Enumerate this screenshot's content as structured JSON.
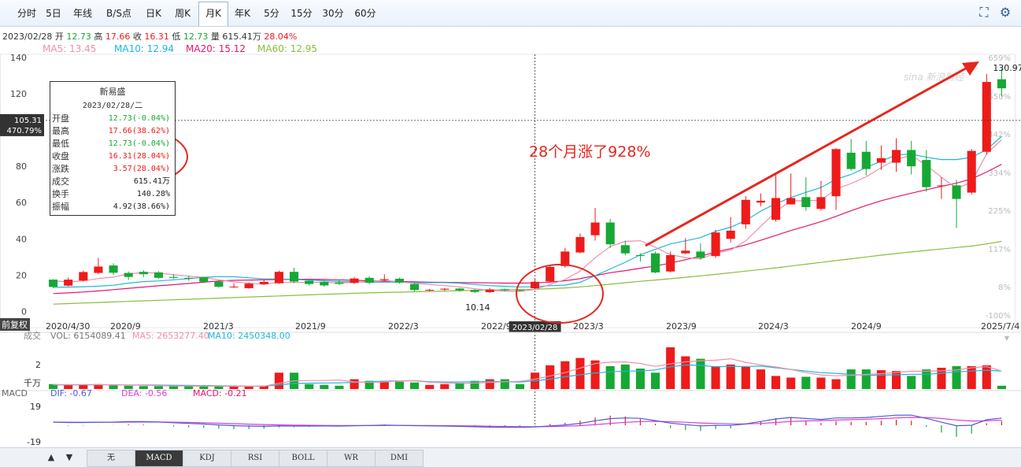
{
  "toolbar": {
    "tabs": [
      "分时",
      "5日",
      "年线",
      "B/S点",
      "日K",
      "周K",
      "月K",
      "年K",
      "5分",
      "15分",
      "30分",
      "60分"
    ],
    "active": "月K",
    "fullscreen_icon": "fullscreen-icon",
    "settings_icon": "settings-icon"
  },
  "info_line": {
    "date": "2023/02/28",
    "open_label": "开",
    "open": "12.73",
    "high_label": "高",
    "high": "17.66",
    "close_label": "收",
    "close": "16.31",
    "low_label": "低",
    "low": "12.73",
    "vol_label": "量",
    "vol": "615.41万",
    "pct": "28.04%"
  },
  "ma_line": {
    "ma5": "MA5: 13.45",
    "ma10": "MA10: 12.94",
    "ma20": "MA20: 15.12",
    "ma60": "MA60: 12.95"
  },
  "colors": {
    "up": "#ee1b1b",
    "down": "#16a834",
    "ma5": "#f08fa8",
    "ma10": "#1bb9d8",
    "ma20": "#e5156d",
    "ma60": "#86be3c",
    "annotation": "#e5271f",
    "dif": "#4f5bd5",
    "dea": "#d93ed8"
  },
  "chart_data": {
    "type": "candlestick",
    "y_axis": {
      "ticks": [
        "140",
        "120",
        "100",
        "80",
        "60",
        "40",
        "20",
        "0"
      ],
      "ylim": [
        -2,
        140
      ]
    },
    "right_axis": {
      "ticks": [
        "659%",
        "550%",
        "442%",
        "334%",
        "225%",
        "117%",
        "8%",
        "-100%"
      ]
    },
    "x_axis": {
      "ticks": [
        "2020/4/30",
        "2020/9",
        "2021/3",
        "2021/9",
        "2022/3",
        "2022/9",
        "2023/3",
        "2023/9",
        "2024/3",
        "2024/9",
        "2025/7/4"
      ]
    },
    "crosshair": {
      "price_label": "105.31",
      "pct_label": "470.79%",
      "date_label": "2023/02/28"
    },
    "max_label": "130.97",
    "min_label": "10.14",
    "watermark": "sina 新浪财经",
    "annotation_text": "28个月涨了928%",
    "candles": [
      [
        17.5,
        13.5,
        17.8,
        12.9
      ],
      [
        14.2,
        17.5,
        18.6,
        13.8
      ],
      [
        17.0,
        21.7,
        22.5,
        16.5
      ],
      [
        21.2,
        24.7,
        29.5,
        20.5
      ],
      [
        25.3,
        21.3,
        26.5,
        20.0
      ],
      [
        21.2,
        19.0,
        22.0,
        17.3
      ],
      [
        21.8,
        20.5,
        22.7,
        18.9
      ],
      [
        21.5,
        18.5,
        22.2,
        17.8
      ],
      [
        19.0,
        18.5,
        20.6,
        17.9
      ],
      [
        18.5,
        18.0,
        19.8,
        16.9
      ],
      [
        18.8,
        16.3,
        19.2,
        15.6
      ],
      [
        16.4,
        13.6,
        17.2,
        13.0
      ],
      [
        13.5,
        13.7,
        15.5,
        12.8
      ],
      [
        12.8,
        15.3,
        15.9,
        12.5
      ],
      [
        15.0,
        16.3,
        17.3,
        14.6
      ],
      [
        15.5,
        21.8,
        22.5,
        15.2
      ],
      [
        21.8,
        16.4,
        24.0,
        15.6
      ],
      [
        16.9,
        15.1,
        17.2,
        14.3
      ],
      [
        16.3,
        14.3,
        16.7,
        13.6
      ],
      [
        16.0,
        15.2,
        17.3,
        14.5
      ],
      [
        15.7,
        18.1,
        19.0,
        15.1
      ],
      [
        18.5,
        15.8,
        19.4,
        15.0
      ],
      [
        17.5,
        17.8,
        20.4,
        16.8
      ],
      [
        18.0,
        15.9,
        18.7,
        15.3
      ],
      [
        15.1,
        11.8,
        15.7,
        10.9
      ],
      [
        11.7,
        11.9,
        12.3,
        11.1
      ],
      [
        12.0,
        12.5,
        12.9,
        11.4
      ],
      [
        12.6,
        11.6,
        13.0,
        10.9
      ],
      [
        11.8,
        10.7,
        12.3,
        10.14
      ],
      [
        10.6,
        12.1,
        13.0,
        10.2
      ],
      [
        12.2,
        11.6,
        12.6,
        11.1
      ],
      [
        11.8,
        11.5,
        12.1,
        11.0
      ],
      [
        12.73,
        16.31,
        17.66,
        12.73
      ],
      [
        16.5,
        24.5,
        25.5,
        16.0
      ],
      [
        25.0,
        33.0,
        35.0,
        24.0
      ],
      [
        32.5,
        41.0,
        43.0,
        32.0
      ],
      [
        42.0,
        49.0,
        57.0,
        39.0
      ],
      [
        49.0,
        37.0,
        51.0,
        35.0
      ],
      [
        36.5,
        32.0,
        39.0,
        31.0
      ],
      [
        31.0,
        30.8,
        32.0,
        27.5
      ],
      [
        32.0,
        21.5,
        33.0,
        21.0
      ],
      [
        22.0,
        31.0,
        33.0,
        21.5
      ],
      [
        32.0,
        33.5,
        40.5,
        31.5
      ],
      [
        33.0,
        29.5,
        37.5,
        28.5
      ],
      [
        30.5,
        43.5,
        45.0,
        29.5
      ],
      [
        40.0,
        44.5,
        52.0,
        38.0
      ],
      [
        48.0,
        61.5,
        63.5,
        45.5
      ],
      [
        60.0,
        61.0,
        65.0,
        58.0
      ],
      [
        50.5,
        62.5,
        75.5,
        49.5
      ],
      [
        59.0,
        62.5,
        76.0,
        59.0
      ],
      [
        63.0,
        57.5,
        74.0,
        55.5
      ],
      [
        56.5,
        63.0,
        72.0,
        55.5
      ],
      [
        63.5,
        89.5,
        90.0,
        56.0
      ],
      [
        87.5,
        78.5,
        95.0,
        77.5
      ],
      [
        88.0,
        78.5,
        94.0,
        75.0
      ],
      [
        82.0,
        84.5,
        91.5,
        78.0
      ],
      [
        82.0,
        89.0,
        95.5,
        77.0
      ],
      [
        89.0,
        80.0,
        94.0,
        75.5
      ],
      [
        83.5,
        68.5,
        89.0,
        66.0
      ],
      [
        69.5,
        69.5,
        74.0,
        62.0
      ],
      [
        69.5,
        62.0,
        72.5,
        46.0
      ],
      [
        65.5,
        88.5,
        89.5,
        64.5
      ],
      [
        88.0,
        126.5,
        130.97,
        86.5
      ],
      [
        128.0,
        123.0,
        134.0,
        118.5
      ]
    ],
    "ma5": [
      16.7,
      16.3,
      16.8,
      18.1,
      18.9,
      20.7,
      21.4,
      21.2,
      20.2,
      19.4,
      18.8,
      17.4,
      16.3,
      15.5,
      15.0,
      16.1,
      15.9,
      16.0,
      16.0,
      15.6,
      16.0,
      16.4,
      17.2,
      16.2,
      15.5,
      14.8,
      14.2,
      13.5,
      12.5,
      11.5,
      11.2,
      11.0,
      12.1,
      14.8,
      17.6,
      22.2,
      29.6,
      35.8,
      38.6,
      39.0,
      35.3,
      31.2,
      29.7,
      28.9,
      32.1,
      33.8,
      38.9,
      46.9,
      55.0,
      61.0,
      61.0,
      61.3,
      67.4,
      70.5,
      74.2,
      79.2,
      83.9,
      86.0,
      80.6,
      74.0,
      67.8,
      71.2,
      86.9,
      94.7
    ],
    "ma10": [
      13.3,
      13.4,
      13.6,
      13.9,
      14.4,
      15.6,
      16.4,
      16.8,
      17.4,
      18.0,
      18.8,
      19.2,
      19.1,
      18.5,
      17.9,
      17.9,
      17.6,
      17.3,
      16.9,
      16.5,
      16.3,
      16.0,
      16.2,
      16.1,
      15.9,
      15.8,
      15.9,
      15.5,
      14.8,
      14.2,
      13.8,
      13.5,
      13.6,
      14.2,
      14.5,
      16.0,
      19.7,
      23.4,
      27.1,
      31.2,
      34.2,
      37.2,
      38.9,
      40.7,
      44.1,
      46.4,
      50.1,
      55.3,
      59.4,
      62.8,
      65.6,
      68.3,
      72.9,
      75.5,
      79.4,
      82.8,
      86.3,
      86.8,
      85.0,
      83.7,
      83.7,
      84.9,
      89.2,
      96.5
    ],
    "ma20": [
      9.8,
      10.2,
      10.7,
      11.3,
      12.0,
      12.7,
      13.4,
      14.1,
      14.7,
      15.4,
      16.1,
      16.7,
      17.1,
      17.3,
      17.4,
      17.6,
      17.7,
      17.7,
      17.6,
      17.4,
      17.1,
      16.9,
      16.7,
      16.5,
      16.3,
      16.1,
      16.0,
      15.9,
      15.8,
      15.7,
      15.6,
      15.6,
      15.7,
      16.1,
      16.9,
      18.0,
      19.7,
      21.3,
      22.5,
      23.8,
      25.0,
      26.6,
      28.5,
      30.5,
      32.7,
      34.6,
      36.7,
      39.2,
      41.9,
      44.6,
      47.0,
      49.5,
      52.4,
      55.5,
      58.4,
      61.0,
      63.2,
      65.2,
      67.1,
      68.9,
      70.7,
      73.1,
      76.8,
      81.1
    ],
    "ma60": [
      4.0,
      4.3,
      4.6,
      4.9,
      5.2,
      5.5,
      5.8,
      6.1,
      6.4,
      6.7,
      7.0,
      7.3,
      7.6,
      7.9,
      8.2,
      8.5,
      8.8,
      9.1,
      9.4,
      9.7,
      10.0,
      10.2,
      10.4,
      10.6,
      10.8,
      11.0,
      11.2,
      11.4,
      11.6,
      11.8,
      11.9,
      12.0,
      12.2,
      12.5,
      12.95,
      13.5,
      14.2,
      15.0,
      15.8,
      16.6,
      17.3,
      18.0,
      18.8,
      19.6,
      20.4,
      21.3,
      22.2,
      23.1,
      24.0,
      25.0,
      26.0,
      27.0,
      28.0,
      29.0,
      30.0,
      31.0,
      31.9,
      32.8,
      33.6,
      34.4,
      35.2,
      36.0,
      37.2,
      38.6
    ]
  },
  "volume": {
    "header_label": "成交",
    "vol": "VOL: 6154089.41",
    "ma5": "MA5: 2653277.40",
    "ma10": "MA10: 2450348.00",
    "axis_top": "2",
    "axis_unit": "千万",
    "values": [
      0.3,
      0.25,
      0.25,
      0.3,
      0.22,
      0.2,
      0.18,
      0.18,
      0.17,
      0.2,
      0.16,
      0.18,
      0.15,
      0.17,
      0.2,
      1.0,
      1.0,
      0.3,
      0.25,
      0.2,
      0.6,
      0.5,
      0.5,
      0.45,
      0.4,
      0.25,
      0.3,
      0.35,
      0.5,
      0.6,
      0.6,
      0.3,
      1.0,
      1.45,
      1.7,
      1.9,
      1.75,
      1.4,
      1.5,
      1.25,
      1.0,
      2.55,
      2.0,
      1.85,
      1.4,
      1.5,
      1.35,
      1.2,
      0.8,
      0.7,
      0.75,
      0.7,
      0.6,
      1.2,
      1.2,
      1.15,
      1.1,
      0.8,
      1.2,
      1.3,
      1.4,
      1.4,
      1.45,
      0.2
    ],
    "ma5_line": [
      0.27,
      0.27,
      0.27,
      0.27,
      0.26,
      0.24,
      0.23,
      0.21,
      0.19,
      0.19,
      0.18,
      0.18,
      0.17,
      0.17,
      0.17,
      0.35,
      0.5,
      0.52,
      0.52,
      0.55,
      0.44,
      0.4,
      0.44,
      0.5,
      0.5,
      0.42,
      0.38,
      0.35,
      0.36,
      0.4,
      0.45,
      0.47,
      0.6,
      0.8,
      1.0,
      1.28,
      1.56,
      1.64,
      1.66,
      1.56,
      1.38,
      1.54,
      1.66,
      1.73,
      1.76,
      1.85,
      1.63,
      1.48,
      1.35,
      1.2,
      1.0,
      0.86,
      0.81,
      0.84,
      0.89,
      0.94,
      1.01,
      1.09,
      1.09,
      1.11,
      1.16,
      1.3,
      1.37,
      1.1
    ],
    "ma10_line": [
      0.25,
      0.25,
      0.26,
      0.26,
      0.26,
      0.25,
      0.25,
      0.24,
      0.23,
      0.22,
      0.21,
      0.2,
      0.19,
      0.18,
      0.18,
      0.26,
      0.34,
      0.36,
      0.37,
      0.38,
      0.4,
      0.45,
      0.48,
      0.5,
      0.51,
      0.45,
      0.43,
      0.43,
      0.45,
      0.46,
      0.45,
      0.43,
      0.5,
      0.6,
      0.75,
      0.87,
      0.98,
      1.05,
      1.1,
      1.1,
      1.17,
      1.36,
      1.47,
      1.45,
      1.36,
      1.39,
      1.38,
      1.4,
      1.3,
      1.2,
      1.1,
      1.0,
      0.96,
      0.9,
      0.84,
      0.85,
      0.87,
      0.9,
      0.9,
      0.97,
      1.05,
      1.1,
      1.15,
      1.1
    ]
  },
  "macd": {
    "header_label": "MACD",
    "dif": "DIF: -0.67",
    "dea": "DEA: -0.56",
    "macd": "MACD: -0.21",
    "axis_top": "19",
    "axis_bottom": "-19"
  },
  "indicator_tabs": [
    "无",
    "MACD",
    "KDJ",
    "RSI",
    "BOLL",
    "WR",
    "DMI"
  ],
  "indicator_active": "MACD",
  "nav": {
    "up": "▲",
    "down": "▼"
  },
  "rehab_label": "前复权",
  "tooltip": {
    "title": "新易盛",
    "date": "2023/02/28/二",
    "rows": [
      {
        "k": "开盘",
        "v": "12.73(-0.04%)",
        "c": "#16a834"
      },
      {
        "k": "最高",
        "v": "17.66(38.62%)",
        "c": "#ee1b1b"
      },
      {
        "k": "最低",
        "v": "12.73(-0.04%)",
        "c": "#16a834"
      },
      {
        "k": "收盘",
        "v": "16.31(28.04%)",
        "c": "#ee1b1b"
      },
      {
        "k": "涨跌",
        "v": "3.57(28.04%)",
        "c": "#ee1b1b"
      },
      {
        "k": "成交",
        "v": "615.41万",
        "c": "#222"
      },
      {
        "k": "换手",
        "v": "140.28%",
        "c": "#222"
      },
      {
        "k": "振幅",
        "v": "4.92(38.66%)",
        "c": "#222"
      }
    ]
  }
}
